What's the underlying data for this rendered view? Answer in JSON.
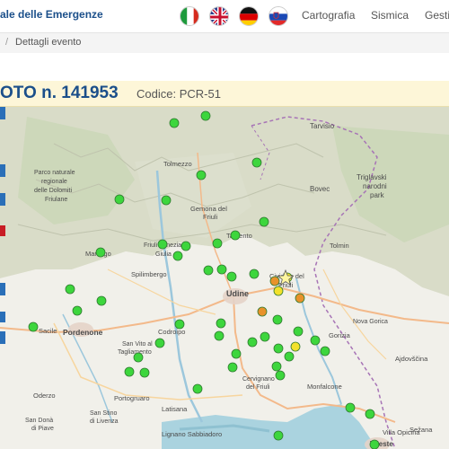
{
  "header": {
    "brand": "ale delle Emergenze",
    "nav": [
      "Cartografia",
      "Sismica",
      "Gesti"
    ],
    "languages": [
      {
        "icon": "italy-flag-icon"
      },
      {
        "icon": "uk-flag-icon"
      },
      {
        "icon": "germany-flag-icon"
      },
      {
        "icon": "slovenia-flag-icon"
      }
    ]
  },
  "breadcrumb": {
    "current": "Dettagli evento"
  },
  "event": {
    "title": "OTO n. 141953",
    "code": "Codice: PCR-51"
  },
  "map": {
    "places": {
      "tarvisio": "Tarvisio",
      "tolmezzo": "Tolmezzo",
      "parco1": "Parco naturale",
      "parco2": "regionale",
      "parco3": "delle Dolomiti",
      "parco4": "Friulane",
      "triglav1": "Triglavski",
      "triglav2": "narodni",
      "triglav3": "park",
      "bovec": "Bovec",
      "gemona1": "Gemona del",
      "gemona2": "Friuli",
      "tarcento": "Tarcento",
      "friuli_venezia1": "Friuli Venezia",
      "friuli_venezia2": "Giulia",
      "maniago": "Maniago",
      "spilimbergo": "Spilimbergo",
      "cividale1": "Cividale del",
      "cividale2": "Friuli",
      "tolmin": "Tolmin",
      "udine": "Udine",
      "sacile": "Sacile",
      "pordenone": "Pordenone",
      "codroipo": "Codroipo",
      "sanvito1": "San Vito al",
      "sanvito2": "Tagliamento",
      "oderzo": "Oderzo",
      "portogruaro": "Portogruaro",
      "latisana": "Latisana",
      "sandona1": "San Donà",
      "sandona2": "di Piave",
      "sandonastn": "San Stino",
      "sandonastn2": "di Livenza",
      "cervignano1": "Cervignano",
      "cervignano2": "del Friuli",
      "monfalcone": "Monfalcone",
      "gorizia": "Gorizia",
      "ajdovscina": "Ajdovščina",
      "lignano": "Lignano Sabbiadoro",
      "opicina": "Villa Opicina",
      "trieste": "Trieste",
      "sezana": "Sežana",
      "nova_gorica": "Nova Gorica"
    },
    "legend_colors": {
      "green": "#3dd63d",
      "orange": "#e8922a",
      "yellow": "#f2e12b"
    }
  }
}
